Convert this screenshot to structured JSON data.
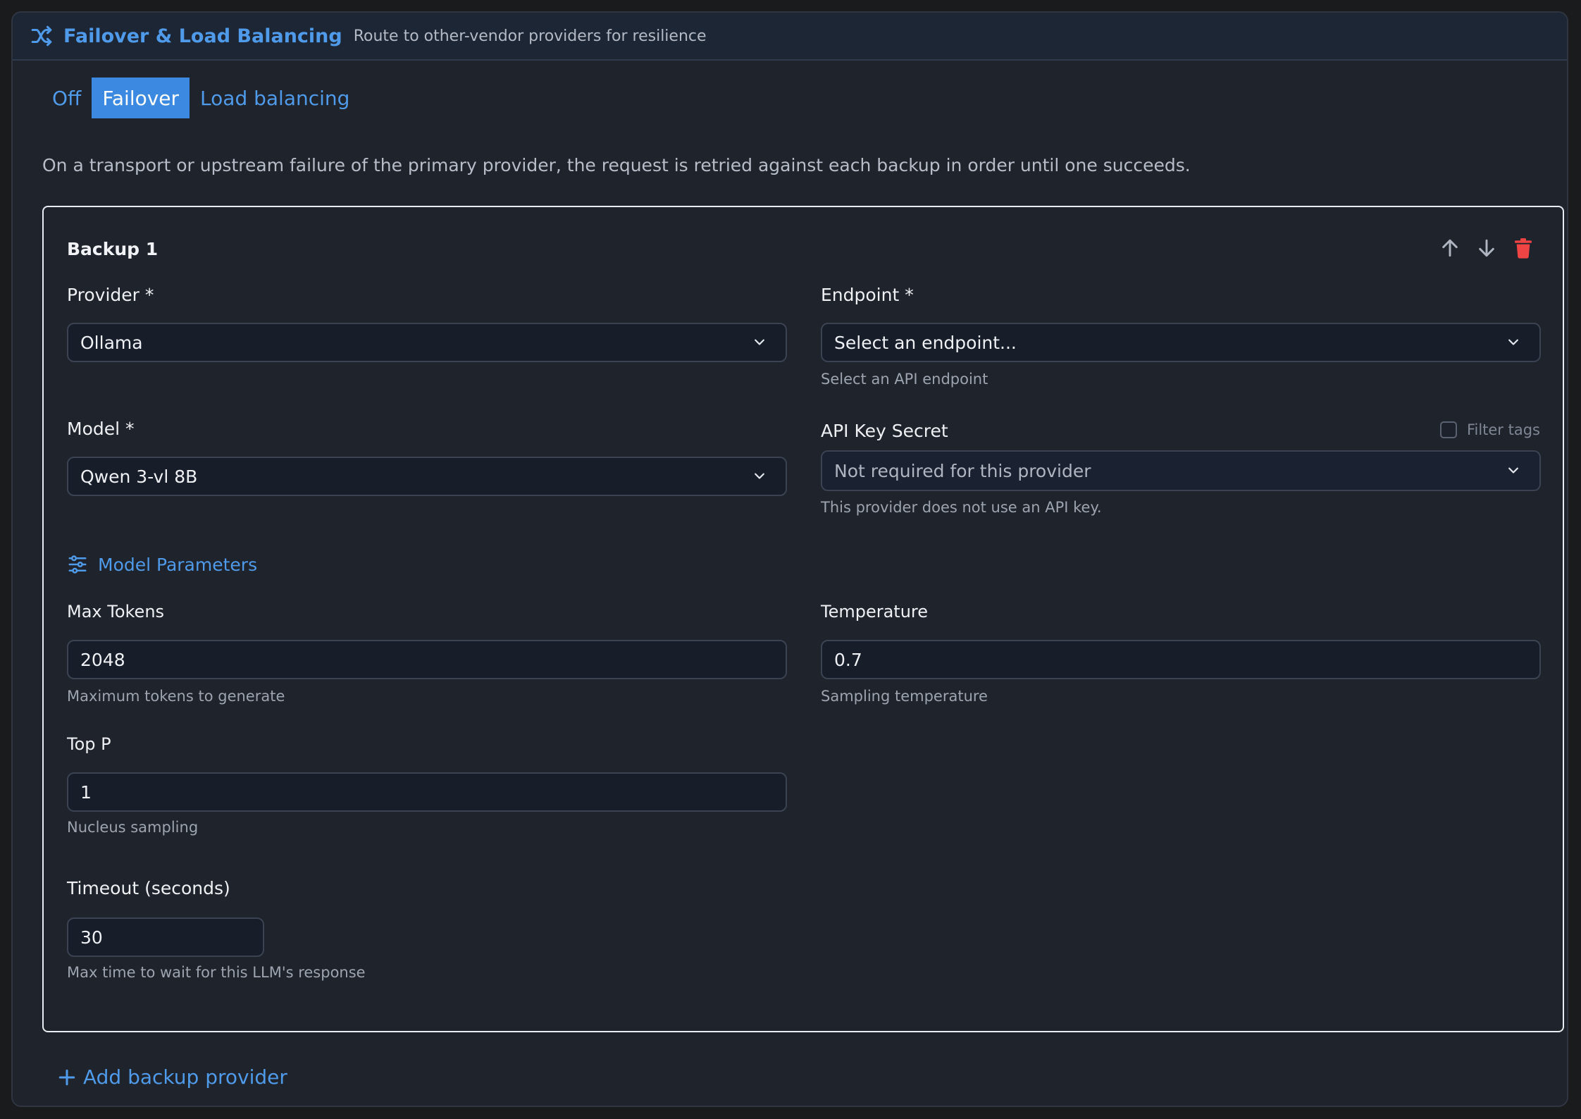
{
  "header": {
    "title": "Failover & Load Balancing",
    "subtitle": "Route to other-vendor providers for resilience",
    "icon": "shuffle-icon"
  },
  "modes": {
    "options": [
      "Off",
      "Failover",
      "Load balancing"
    ],
    "selected": "Failover"
  },
  "description": "On a transport or upstream failure of the primary provider, the request is retried against each backup in order until one succeeds.",
  "backup": {
    "title": "Backup 1",
    "provider": {
      "label": "Provider *",
      "value": "Ollama"
    },
    "endpoint": {
      "label": "Endpoint *",
      "placeholder": "Select an endpoint...",
      "hint": "Select an API endpoint"
    },
    "model": {
      "label": "Model *",
      "value": "Qwen 3-vl 8B"
    },
    "api_key": {
      "label": "API Key Secret",
      "value": "Not required for this provider",
      "hint": "This provider does not use an API key.",
      "filter_tags_label": "Filter tags",
      "filter_tags_checked": false
    },
    "params_label": "Model Parameters",
    "max_tokens": {
      "label": "Max Tokens",
      "value": "2048",
      "hint": "Maximum tokens to generate"
    },
    "temperature": {
      "label": "Temperature",
      "value": "0.7",
      "hint": "Sampling temperature"
    },
    "top_p": {
      "label": "Top P",
      "value": "1",
      "hint": "Nucleus sampling"
    },
    "timeout": {
      "label": "Timeout (seconds)",
      "value": "30",
      "hint": "Max time to wait for this LLM's response"
    }
  },
  "add_backup_label": "Add backup provider",
  "colors": {
    "accent": "#4f9ae9",
    "active_tab": "#3b89e0",
    "danger": "#ef4444"
  }
}
